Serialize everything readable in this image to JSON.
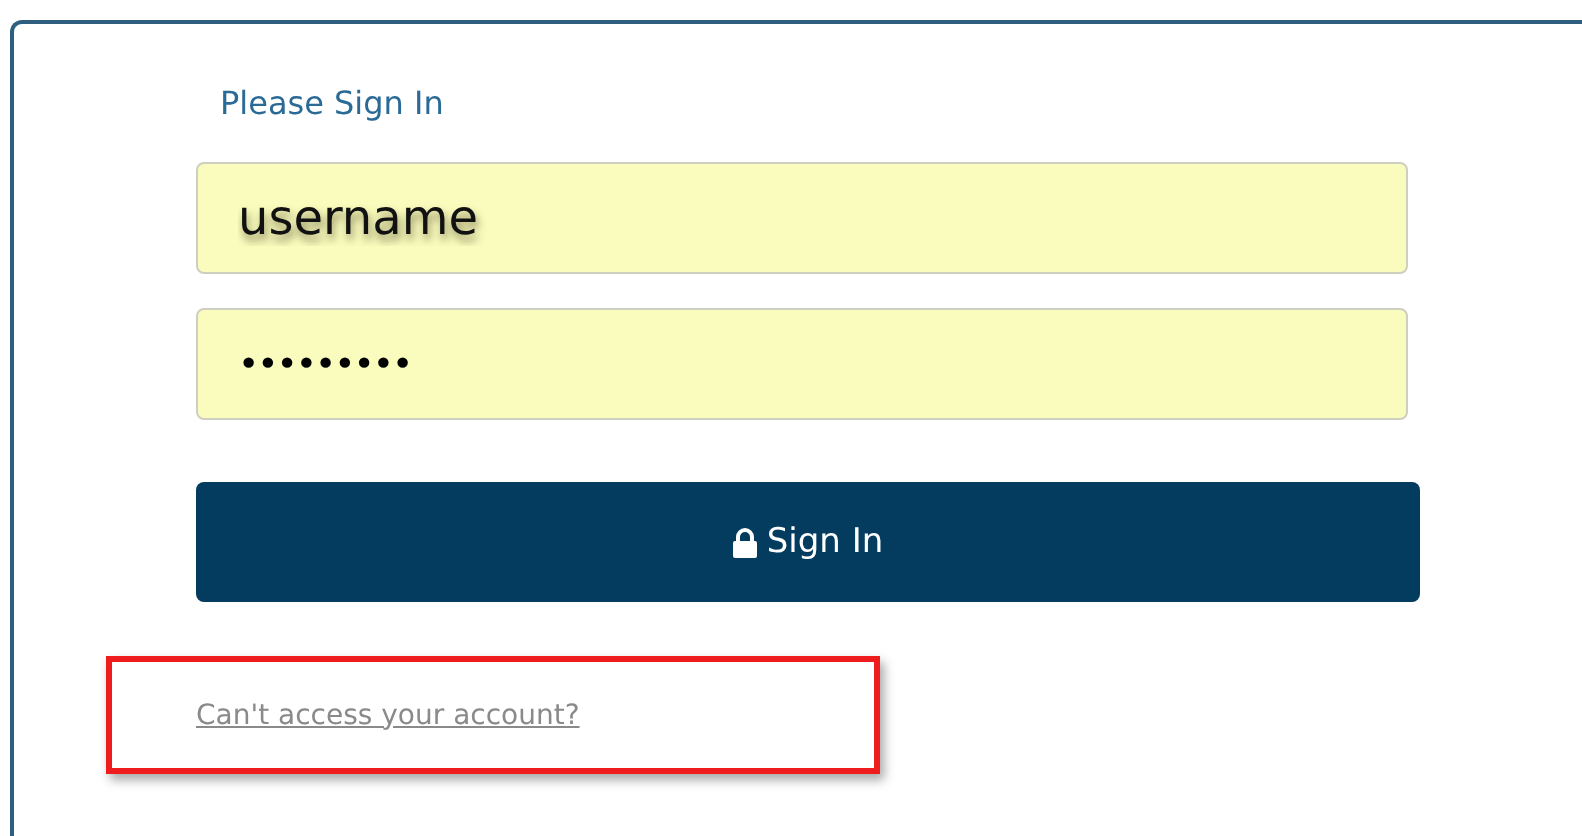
{
  "form": {
    "title": "Please Sign In",
    "fields": [
      {
        "kind": "text",
        "value": "username"
      },
      {
        "kind": "password",
        "value": "•••••••••"
      }
    ],
    "submit_button": "Sign In",
    "help_link": {
      "label": "Can't access your account?",
      "highlighted": true
    }
  }
}
